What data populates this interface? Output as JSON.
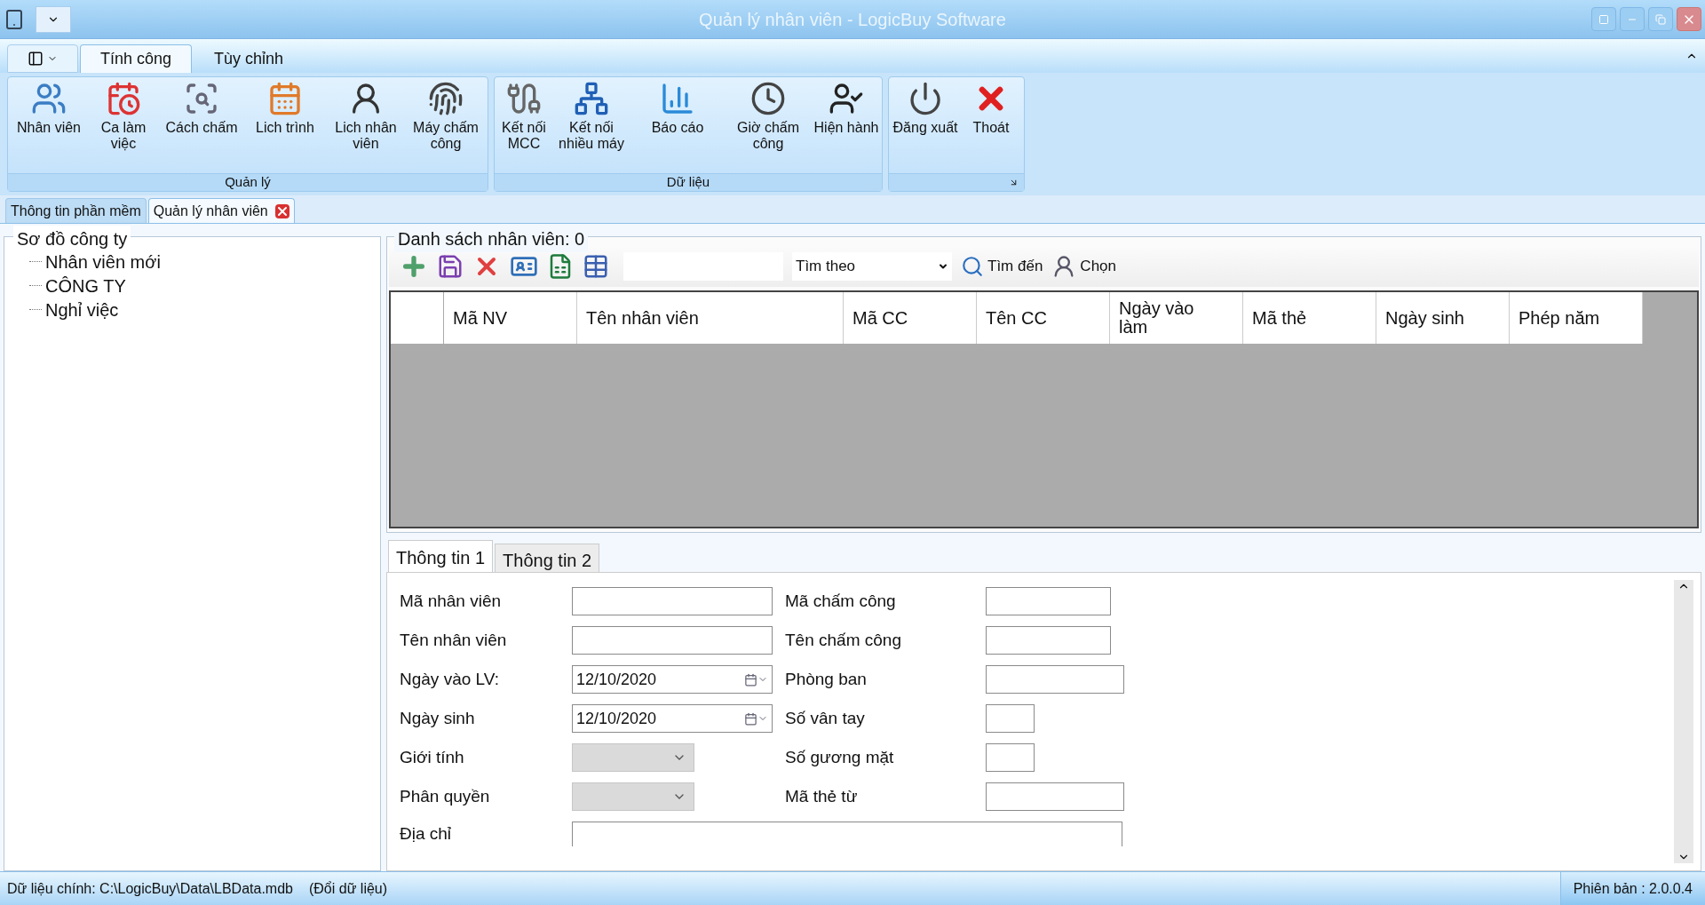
{
  "window": {
    "title": "Quản lý nhân viên - LogicBuy Software"
  },
  "ribbon_tabs": [
    {
      "label": "Tính công",
      "selected": true
    },
    {
      "label": "Tùy chỉnh",
      "selected": false
    }
  ],
  "ribbon_groups": [
    {
      "label": "Quản lý",
      "buttons": [
        "Nhân viên",
        "Ca làm việc",
        "Cách chấm",
        "Lich trình",
        "Lich nhân viên",
        "Máy chấm công"
      ]
    },
    {
      "label": "Dữ liệu",
      "buttons": [
        "Kết nối MCC",
        "Kết nối nhiều máy",
        "Báo cáo",
        "Giờ chấm công",
        "Hiện hành"
      ]
    },
    {
      "buttons": [
        "Đăng xuất",
        "Thoát"
      ]
    }
  ],
  "doc_tabs": [
    {
      "label": "Thông tin phần mềm",
      "selected": false,
      "closable": false
    },
    {
      "label": "Quản lý nhân viên",
      "selected": true,
      "closable": true
    }
  ],
  "tree": {
    "title": "Sơ đồ công ty",
    "items": [
      {
        "label": "Nhân viên mới"
      },
      {
        "label": "CÔNG TY"
      },
      {
        "label": "Nghỉ việc"
      }
    ]
  },
  "employee_list": {
    "title": "Danh sách nhân viên: 0",
    "search_by": "Tìm theo",
    "find_button": "Tìm đến",
    "select_button": "Chọn",
    "columns": [
      "Mã NV",
      "Tên nhân viên",
      "Mã CC",
      "Tên CC",
      "Ngày vào làm",
      "Mã thẻ",
      "Ngày sinh",
      "Phép năm"
    ]
  },
  "detail_tabs": [
    {
      "label": "Thông tin 1",
      "selected": true
    },
    {
      "label": "Thông tin 2",
      "selected": false
    }
  ],
  "form_left": [
    {
      "label": "Mã nhân viên",
      "kind": "text",
      "disabled": false
    },
    {
      "label": "Tên nhân viên",
      "kind": "text",
      "disabled": false
    },
    {
      "label": "Ngày vào LV:",
      "kind": "date",
      "value": "12/10/2020",
      "disabled": false
    },
    {
      "label": "Ngày sinh",
      "kind": "date",
      "value": "12/10/2020",
      "disabled": false
    },
    {
      "label": "Giới tính",
      "kind": "combo",
      "disabled": true
    },
    {
      "label": "Phân quyền",
      "kind": "combo",
      "disabled": true
    }
  ],
  "form_right": [
    {
      "label": "Mã chấm công",
      "kind": "text",
      "disabled": false
    },
    {
      "label": "Tên chấm công",
      "kind": "text",
      "disabled": false
    },
    {
      "label": "Phòng ban",
      "kind": "text",
      "disabled": false
    },
    {
      "label": "Số vân tay",
      "kind": "text",
      "disabled": false
    },
    {
      "label": "Số gương mặt",
      "kind": "text",
      "disabled": false
    },
    {
      "label": "Mã thẻ từ",
      "kind": "text",
      "disabled": false
    }
  ],
  "address": {
    "label": "Địa chỉ"
  },
  "status_bar": {
    "data_path": "Dữ liệu chính: C:\\LogicBuy\\Data\\LBData.mdb",
    "change_data": "(Đổi dữ liệu)",
    "version": "Phiên bản : 2.0.0.4"
  }
}
